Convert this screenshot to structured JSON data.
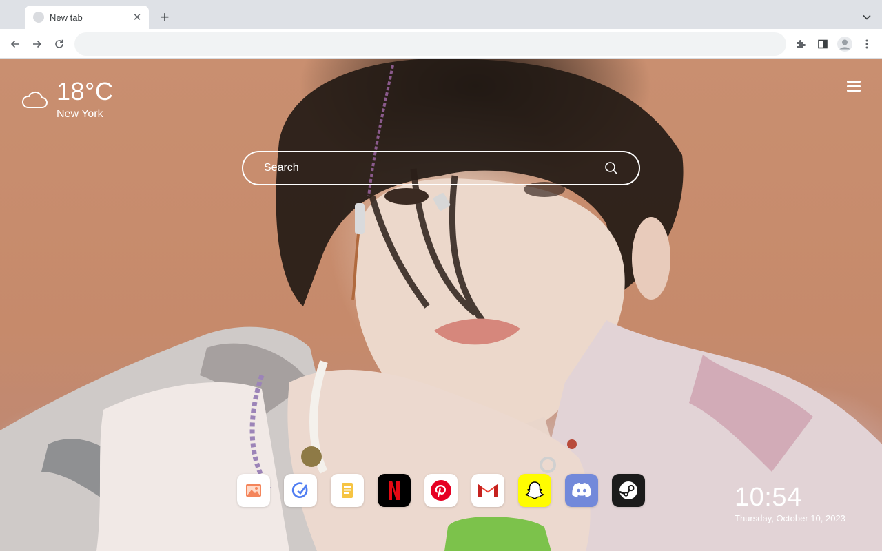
{
  "browser": {
    "tab": {
      "title": "New tab",
      "close_glyph": "✕"
    },
    "new_tab_glyph": "+",
    "omnibox": {
      "value": ""
    }
  },
  "weather": {
    "temperature": "18°C",
    "city": "New York",
    "icon": "cloud-icon"
  },
  "search": {
    "placeholder": "Search"
  },
  "apps": [
    {
      "name": "photos-app",
      "icon": "image-icon",
      "bg": "#ffffff"
    },
    {
      "name": "tasks-app",
      "icon": "check-circle-icon",
      "bg": "#ffffff"
    },
    {
      "name": "notes-app",
      "icon": "notepad-icon",
      "bg": "#ffffff"
    },
    {
      "name": "netflix-app",
      "icon": "netflix-icon",
      "bg": "#000000"
    },
    {
      "name": "pinterest-app",
      "icon": "pinterest-icon",
      "bg": "#ffffff"
    },
    {
      "name": "gmail-app",
      "icon": "gmail-icon",
      "bg": "#ffffff"
    },
    {
      "name": "snapchat-app",
      "icon": "snapchat-icon",
      "bg": "#fffc00"
    },
    {
      "name": "discord-app",
      "icon": "discord-icon",
      "bg": "#7289da"
    },
    {
      "name": "steam-app",
      "icon": "steam-icon",
      "bg": "#1b1b1b"
    }
  ],
  "clock": {
    "time": "10:54",
    "date": "Thursday, October 10, 2023"
  }
}
